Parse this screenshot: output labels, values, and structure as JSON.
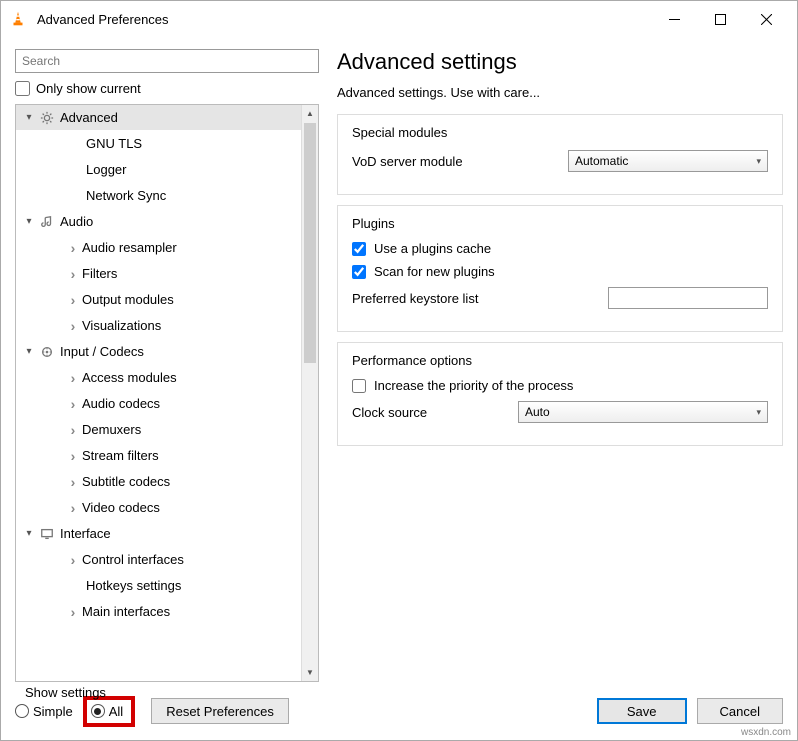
{
  "window": {
    "title": "Advanced Preferences"
  },
  "sidebar": {
    "search_placeholder": "Search",
    "only_show": "Only show current",
    "tree": [
      {
        "label": "Advanced",
        "type": "cat",
        "icon": "gear",
        "selected": true,
        "chev": "down"
      },
      {
        "label": "GNU TLS",
        "type": "child",
        "indent": 2
      },
      {
        "label": "Logger",
        "type": "child",
        "indent": 2
      },
      {
        "label": "Network Sync",
        "type": "child",
        "indent": 2
      },
      {
        "label": "Audio",
        "type": "cat",
        "icon": "audio",
        "chev": "down"
      },
      {
        "label": "Audio resampler",
        "type": "child",
        "indent": 1,
        "chev": "right"
      },
      {
        "label": "Filters",
        "type": "child",
        "indent": 1,
        "chev": "right"
      },
      {
        "label": "Output modules",
        "type": "child",
        "indent": 1,
        "chev": "right"
      },
      {
        "label": "Visualizations",
        "type": "child",
        "indent": 1,
        "chev": "right"
      },
      {
        "label": "Input / Codecs",
        "type": "cat",
        "icon": "codec",
        "chev": "down"
      },
      {
        "label": "Access modules",
        "type": "child",
        "indent": 1,
        "chev": "right"
      },
      {
        "label": "Audio codecs",
        "type": "child",
        "indent": 1,
        "chev": "right"
      },
      {
        "label": "Demuxers",
        "type": "child",
        "indent": 1,
        "chev": "right"
      },
      {
        "label": "Stream filters",
        "type": "child",
        "indent": 1,
        "chev": "right"
      },
      {
        "label": "Subtitle codecs",
        "type": "child",
        "indent": 1,
        "chev": "right"
      },
      {
        "label": "Video codecs",
        "type": "child",
        "indent": 1,
        "chev": "right"
      },
      {
        "label": "Interface",
        "type": "cat",
        "icon": "interface",
        "chev": "down"
      },
      {
        "label": "Control interfaces",
        "type": "child",
        "indent": 1,
        "chev": "right"
      },
      {
        "label": "Hotkeys settings",
        "type": "child",
        "indent": 2
      },
      {
        "label": "Main interfaces",
        "type": "child",
        "indent": 1,
        "chev": "right"
      }
    ]
  },
  "main": {
    "heading": "Advanced settings",
    "sub": "Advanced settings. Use with care...",
    "groups": {
      "special": {
        "title": "Special modules",
        "vod_label": "VoD server module",
        "vod_value": "Automatic"
      },
      "plugins": {
        "title": "Plugins",
        "cache": "Use a plugins cache",
        "scan": "Scan for new plugins",
        "keystore": "Preferred keystore list"
      },
      "perf": {
        "title": "Performance options",
        "priority": "Increase the priority of the process",
        "clock_label": "Clock source",
        "clock_value": "Auto"
      }
    }
  },
  "footer": {
    "show": "Show settings",
    "simple": "Simple",
    "all": "All",
    "reset": "Reset Preferences",
    "save": "Save",
    "cancel": "Cancel"
  },
  "watermark": "wsxdn.com"
}
